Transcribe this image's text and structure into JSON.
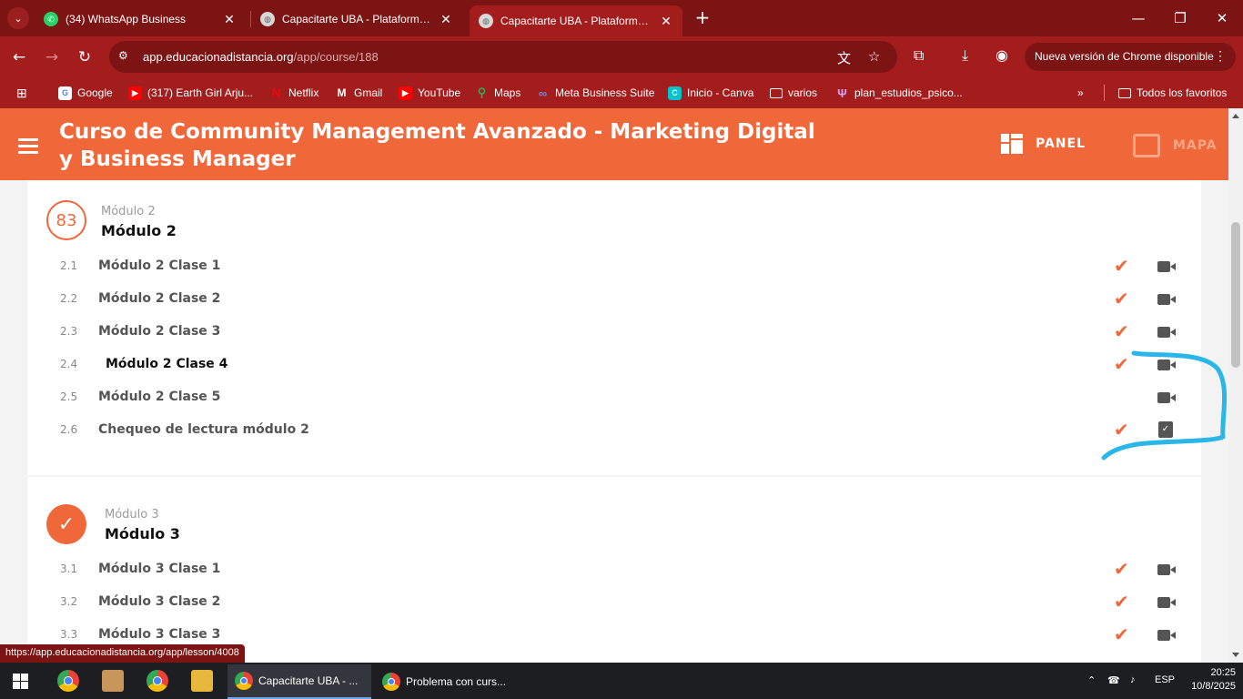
{
  "browser": {
    "tabs": [
      {
        "title": "(34) WhatsApp Business",
        "icon": "whatsapp-icon"
      },
      {
        "title": "Capacitarte UBA - Plataforma de",
        "icon": "globe-icon"
      },
      {
        "title": "Capacitarte UBA - Plataforma de",
        "icon": "globe-icon",
        "active": true
      }
    ],
    "url_host": "app.educacionadistancia.org",
    "url_path": "/app/course/188",
    "update_label": "Nueva versión de Chrome disponible",
    "bookmarks": [
      {
        "label": "Google",
        "icon": "google-icon"
      },
      {
        "label": "(317) Earth Girl Arju...",
        "icon": "youtube-icon"
      },
      {
        "label": "Netflix",
        "icon": "netflix-icon"
      },
      {
        "label": "Gmail",
        "icon": "gmail-icon"
      },
      {
        "label": "YouTube",
        "icon": "youtube-icon"
      },
      {
        "label": "Maps",
        "icon": "maps-icon"
      },
      {
        "label": "Meta Business Suite",
        "icon": "meta-icon"
      },
      {
        "label": "Inicio - Canva",
        "icon": "canva-icon"
      },
      {
        "label": "varios",
        "icon": "folder-icon"
      },
      {
        "label": "plan_estudios_psico...",
        "icon": "psi-icon"
      }
    ],
    "all_bookmarks_label": "Todos los favoritos",
    "status_link": "https://app.educacionadistancia.org/app/lesson/4008"
  },
  "header": {
    "course_title_line1": "Curso de Community Management Avanzado - Marketing Digital",
    "course_title_line2": "y Business Manager",
    "panel_label": "PANEL",
    "mapa_label": "MAPA",
    "accent_color": "#f0673a"
  },
  "modules": [
    {
      "badge": "83",
      "subtitle": "Módulo 2",
      "title": "Módulo 2",
      "lessons": [
        {
          "num": "2.1",
          "label": "Módulo 2 Clase 1",
          "done": true,
          "type": "video"
        },
        {
          "num": "2.2",
          "label": "Módulo 2 Clase 2",
          "done": true,
          "type": "video"
        },
        {
          "num": "2.3",
          "label": "Módulo 2 Clase 3",
          "done": true,
          "type": "video"
        },
        {
          "num": "2.4",
          "label": "Módulo 2 Clase 4",
          "done": true,
          "type": "video",
          "current": true
        },
        {
          "num": "2.5",
          "label": "Módulo 2 Clase 5",
          "done": false,
          "type": "video"
        },
        {
          "num": "2.6",
          "label": "Chequeo de lectura módulo 2",
          "done": true,
          "type": "quiz"
        }
      ]
    },
    {
      "badge": "✓",
      "subtitle": "Módulo 3",
      "title": "Módulo 3",
      "lessons": [
        {
          "num": "3.1",
          "label": "Módulo 3 Clase 1",
          "done": true,
          "type": "video"
        },
        {
          "num": "3.2",
          "label": "Módulo 3 Clase 2",
          "done": true,
          "type": "video"
        },
        {
          "num": "3.3",
          "label": "Módulo 3 Clase 3",
          "done": true,
          "type": "video"
        }
      ]
    }
  ],
  "taskbar": {
    "windows": [
      {
        "label": "Capacitarte UBA - ...",
        "active": true
      },
      {
        "label": "Problema con curs...",
        "active": false
      }
    ],
    "language": "ESP",
    "time": "20:25",
    "date": "10/8/2025"
  }
}
